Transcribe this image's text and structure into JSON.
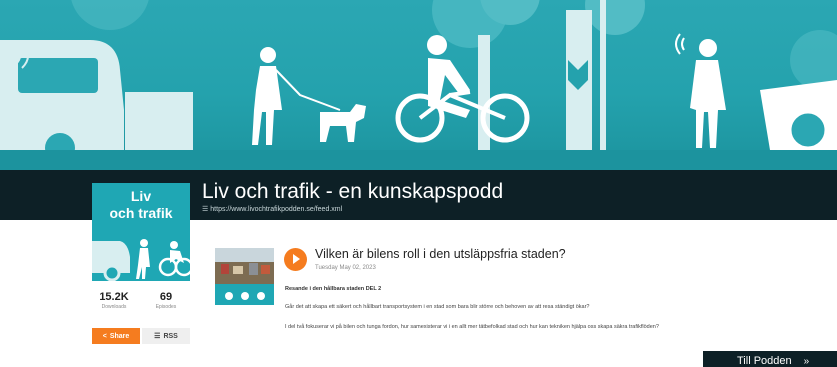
{
  "podcast": {
    "title": "Liv och trafik - en kunskapspodd",
    "feed_url": "https://www.livochtrafikpodden.se/feed.xml",
    "cover_line1": "Liv",
    "cover_line2": "och trafik"
  },
  "stats": {
    "downloads_value": "15.2K",
    "downloads_label": "Downloads",
    "episodes_value": "69",
    "episodes_label": "Episodes"
  },
  "actions": {
    "share_label": "Share",
    "rss_label": "RSS",
    "till_podden_label": "Till Podden"
  },
  "episode": {
    "title": "Vilken är bilens roll i den utsläppsfria staden?",
    "date": "Tuesday May 02, 2023",
    "subtitle": "Resande i den hållbara staden DEL 2",
    "paragraph1": "Går det att skapa ett säkert och hållbart transportsystem i en stad som bara blir större och behoven av att resa ständigt ökar?",
    "paragraph2": "I del två fokuserar vi på bilen och tunga fordon, hur samexisterar vi i en allt mer tätbefolkad stad och hur kan tekniken hjälpa oss skapa säkra trafikflöden?"
  },
  "icons": [
    "share-icon",
    "rss-icon",
    "play-icon",
    "chevron-right-icon"
  ],
  "colors": {
    "accent": "#f57c1f",
    "banner": "#24a2ad",
    "dark": "#0d2026"
  }
}
